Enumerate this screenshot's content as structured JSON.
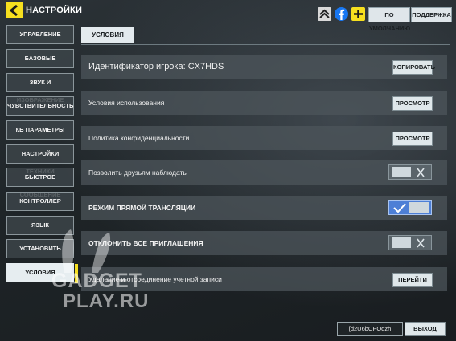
{
  "header": {
    "title": "НАСТРОЙКИ",
    "default_label": "ПО УМОЛЧАНИЮ",
    "support_label": "ПОДДЕРЖКА"
  },
  "top_icons": [
    "rank-icon",
    "facebook-icon",
    "plus-icon"
  ],
  "sidebar": {
    "items": [
      {
        "label": "УПРАВЛЕНИЕ"
      },
      {
        "label": "БАЗОВЫЕ"
      },
      {
        "label": "ЗВУК И ИЗОБРАЖЕНИЕ"
      },
      {
        "label": "ЧУВСТВИТЕЛЬНОСТЬ"
      },
      {
        "label": "КБ ПАРАМЕТРЫ"
      },
      {
        "label": "НАСТРОЙКИ ТЕХНИКИ"
      },
      {
        "label": "БЫСТРОЕ СООБЩЕНИЕ"
      },
      {
        "label": "КОНТРОЛЛЕР"
      },
      {
        "label": "ЯЗЫК"
      },
      {
        "label": "УСТАНОВИТЬ"
      },
      {
        "label": "УСЛОВИЯ"
      }
    ],
    "active_index": 10
  },
  "tab": {
    "label": "УСЛОВИЯ"
  },
  "rows": [
    {
      "label": "Идентификатор игрока: CX7HDS",
      "button": "КОПИРОВАТЬ"
    },
    {
      "label": "Условия использования",
      "button": "ПРОСМОТР"
    },
    {
      "label": "Политика конфиденциальности",
      "button": "ПРОСМОТР"
    },
    {
      "label": "Позволить друзьям наблюдать",
      "toggle": false
    },
    {
      "label": "РЕЖИМ ПРЯМОЙ ТРАНСЛЯЦИИ",
      "toggle": true
    },
    {
      "label": "ОТКЛОНИТЬ ВСЕ ПРИГЛАШЕНИЯ",
      "toggle": false
    },
    {
      "label": "Удаление и отсоединение учетной записи",
      "button": "ПЕРЕЙТИ"
    }
  ],
  "footer": {
    "id_text": "[d2U6bCPOqzh",
    "exit_label": "ВЫХОД"
  },
  "watermark": {
    "line1": "GADGET",
    "line2": "PLAY.RU"
  },
  "colors": {
    "accent": "#f6df1f",
    "toggle_on": "#4d7fd6",
    "facebook": "#1877f2"
  }
}
